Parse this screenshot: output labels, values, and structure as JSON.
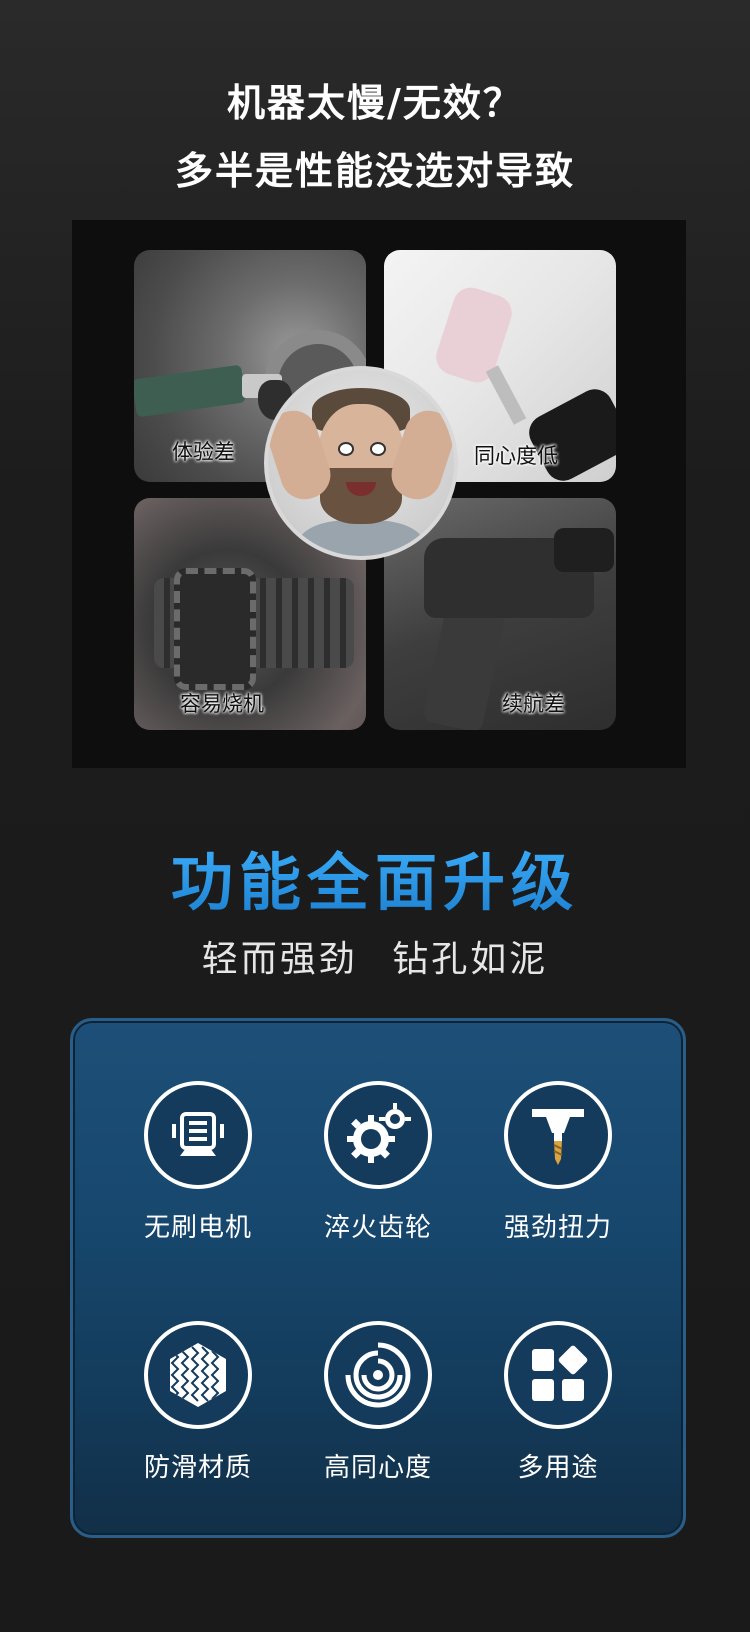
{
  "header": {
    "line1": "机器太慢/无效？",
    "line2": "多半是性能没选对导致"
  },
  "collage": {
    "tiles": [
      {
        "label": "体验差"
      },
      {
        "label": "同心度低"
      },
      {
        "label": "容易烧机"
      },
      {
        "label": "续航差"
      }
    ]
  },
  "upgrade": {
    "title": "功能全面升级",
    "subtitle": "轻而强劲  钻孔如泥"
  },
  "features": [
    {
      "label": "无刷电机",
      "icon": "brushless-motor-icon"
    },
    {
      "label": "淬火齿轮",
      "icon": "gears-icon"
    },
    {
      "label": "强劲扭力",
      "icon": "drill-bit-icon"
    },
    {
      "label": "防滑材质",
      "icon": "hexagon-texture-icon"
    },
    {
      "label": "高同心度",
      "icon": "concentric-circles-icon"
    },
    {
      "label": "多用途",
      "icon": "multi-purpose-icon"
    }
  ],
  "colors": {
    "accent": "#2a8fd8",
    "panel": "#17476d",
    "background": "#1c1c1c",
    "bit_gold": "#d9a441"
  }
}
